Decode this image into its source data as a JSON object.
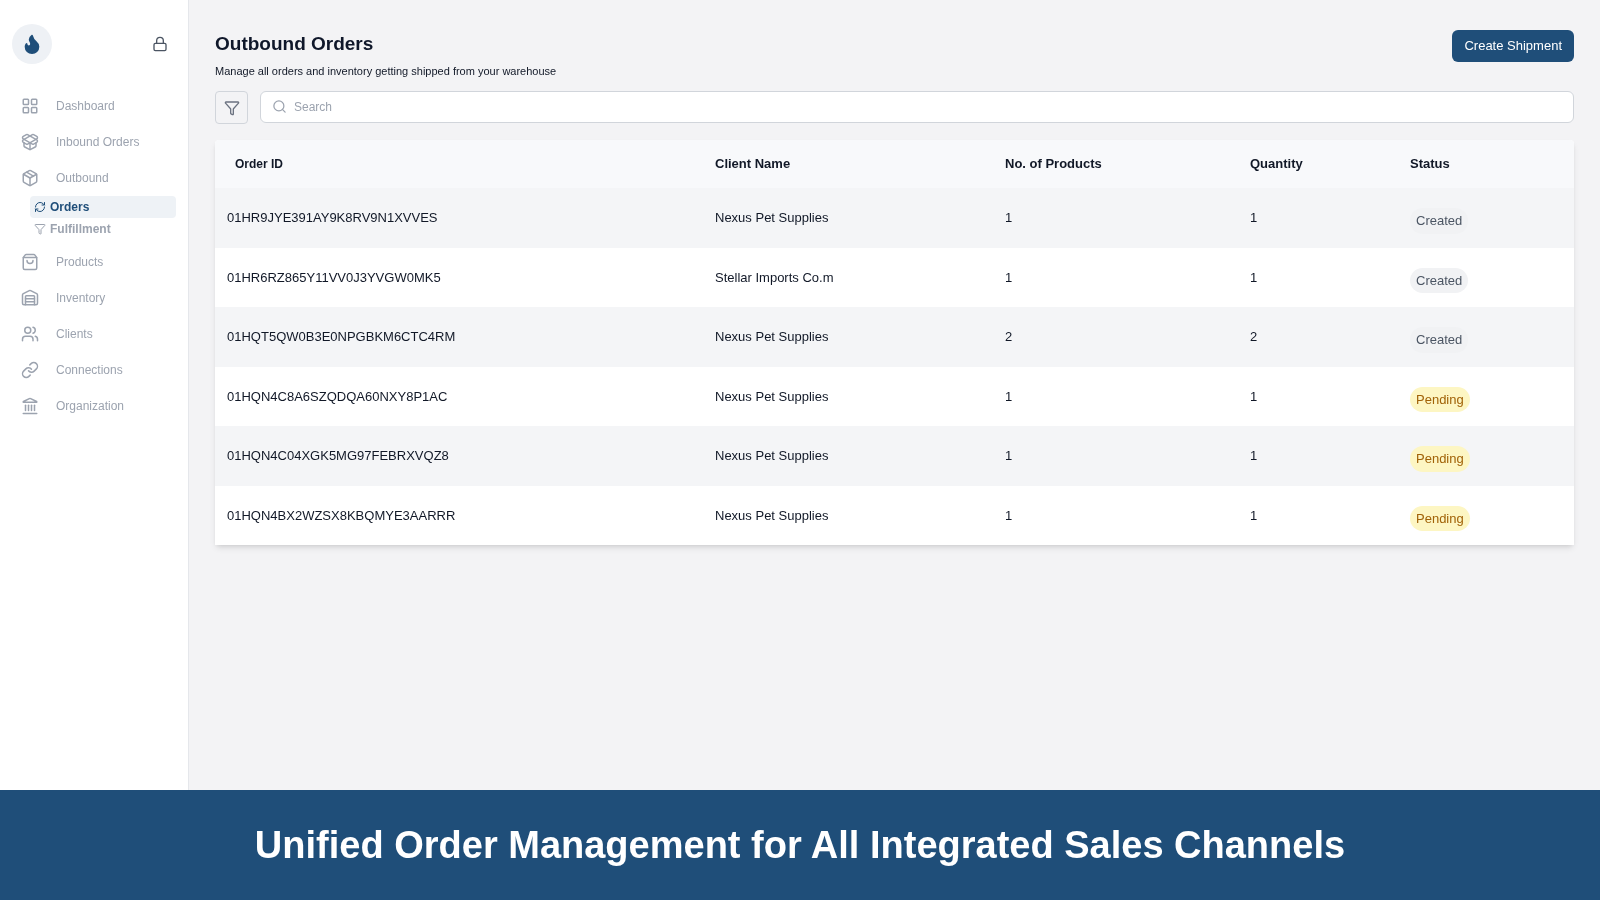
{
  "sidebar": {
    "items": [
      {
        "label": "Dashboard",
        "selected": false
      },
      {
        "label": "Inbound Orders",
        "selected": false
      },
      {
        "label": "Outbound",
        "selected": false,
        "children": [
          {
            "label": "Orders",
            "selected": true
          },
          {
            "label": "Fulfillment",
            "selected": false
          }
        ]
      },
      {
        "label": "Products",
        "selected": false
      },
      {
        "label": "Inventory",
        "selected": false
      },
      {
        "label": "Clients",
        "selected": false
      },
      {
        "label": "Connections",
        "selected": false
      },
      {
        "label": "Organization",
        "selected": false
      }
    ]
  },
  "header": {
    "title": "Outbound Orders",
    "subtitle": "Manage all orders and inventory getting shipped from your warehouse",
    "button": "Create Shipment"
  },
  "search": {
    "placeholder": "Search"
  },
  "table": {
    "columns": [
      "Order ID",
      "Client Name",
      "No. of Products",
      "Quantity",
      "Status"
    ],
    "rows": [
      {
        "order_id": "01HR9JYE391AY9K8RV9N1XVVES",
        "client": "Nexus Pet Supplies",
        "products": "1",
        "quantity": "1",
        "status": "Created",
        "kind": "created"
      },
      {
        "order_id": "01HR6RZ865Y11VV0J3YVGW0MK5",
        "client": "Stellar Imports Co.m",
        "products": "1",
        "quantity": "1",
        "status": "Created",
        "kind": "created"
      },
      {
        "order_id": "01HQT5QW0B3E0NPGBKM6CTC4RM",
        "client": "Nexus Pet Supplies",
        "products": "2",
        "quantity": "2",
        "status": "Created",
        "kind": "created"
      },
      {
        "order_id": "01HQN4C8A6SZQDQA60NXY8P1AC",
        "client": "Nexus Pet Supplies",
        "products": "1",
        "quantity": "1",
        "status": "Pending",
        "kind": "pending"
      },
      {
        "order_id": "01HQN4C04XGK5MG97FEBRXVQZ8",
        "client": "Nexus Pet Supplies",
        "products": "1",
        "quantity": "1",
        "status": "Pending",
        "kind": "pending"
      },
      {
        "order_id": "01HQN4BX2WZSX8KBQMYE3AARRR",
        "client": "Nexus Pet Supplies",
        "products": "1",
        "quantity": "1",
        "status": "Pending",
        "kind": "pending"
      }
    ]
  },
  "banner": {
    "text": "Unified Order Management for All Integrated Sales Channels"
  }
}
